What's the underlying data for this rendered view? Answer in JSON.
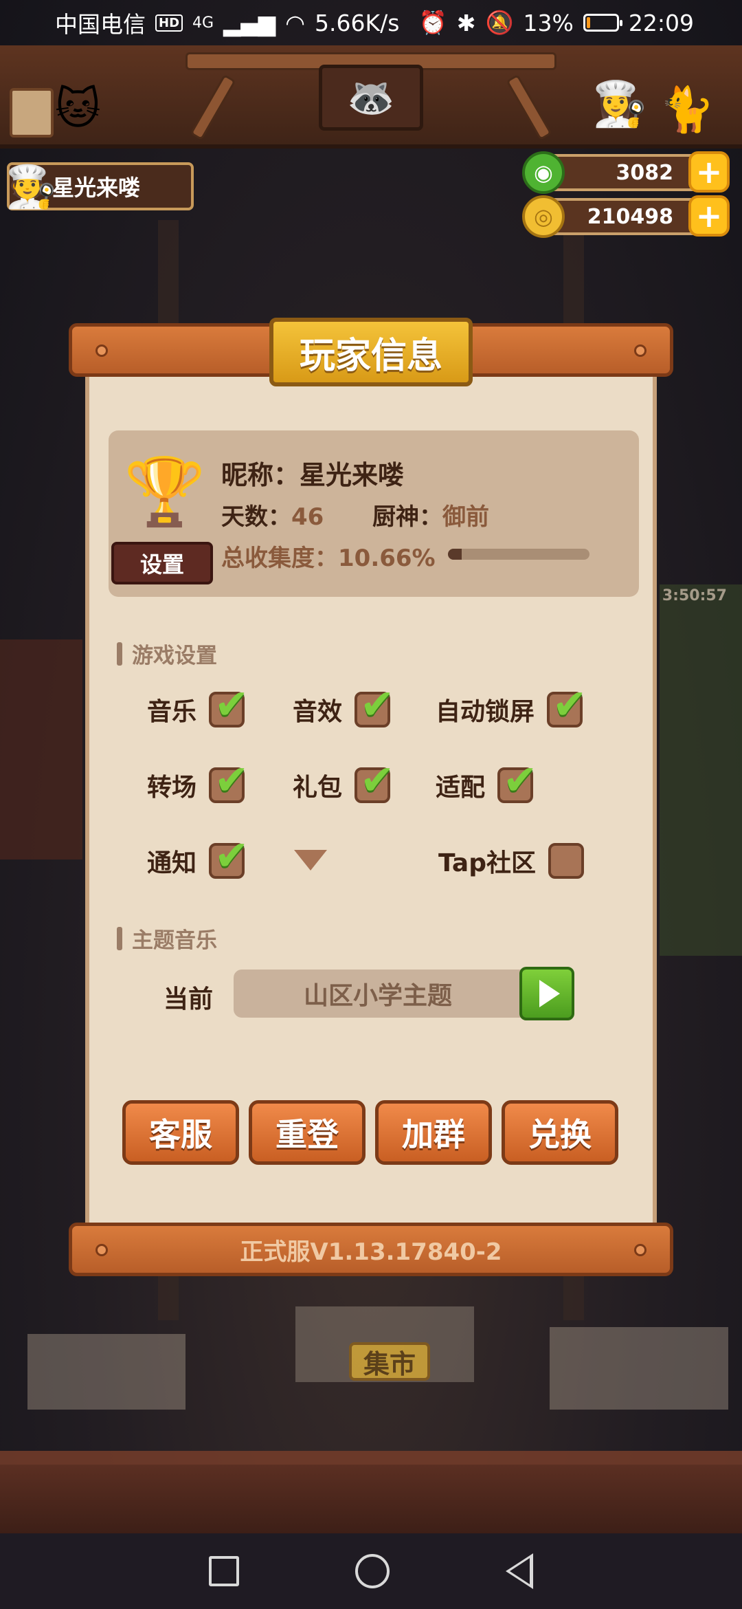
{
  "status_bar": {
    "carrier": "中国电信",
    "hd": "HD",
    "network": "4G",
    "speed": "5.66K/s",
    "battery": "13%",
    "battery_level": 0.13,
    "time": "22:09"
  },
  "player_tag": {
    "name": "星光来喽"
  },
  "currencies": {
    "gems": "3082",
    "coins": "210498"
  },
  "dialog": {
    "title": "玩家信息",
    "nickname_label": "昵称：",
    "nickname_value": "星光来喽",
    "days_label": "天数：",
    "days_value": "46",
    "chef_label": "厨神：",
    "chef_value": "御前",
    "collection_label": "总收集度：",
    "collection_value": "10.66%",
    "collection_progress": 0.0966,
    "settings_button": "设置",
    "game_settings_heading": "游戏设置",
    "options": [
      {
        "label": "音乐",
        "checked": true
      },
      {
        "label": "音效",
        "checked": true
      },
      {
        "label": "自动锁屏",
        "checked": true
      },
      {
        "label": "转场",
        "checked": true
      },
      {
        "label": "礼包",
        "checked": true
      },
      {
        "label": "适配",
        "checked": true
      },
      {
        "label": "通知",
        "checked": true
      },
      {
        "label": "Tap社区",
        "checked": false
      }
    ],
    "theme_music_heading": "主题音乐",
    "current_label": "当前",
    "current_theme": "山区小学主题",
    "buttons": {
      "support": "客服",
      "relogin": "重登",
      "join_group": "加群",
      "redeem": "兑换"
    },
    "version": "正式服V1.13.17840-2"
  },
  "background": {
    "market_sign": "集市",
    "side_countdown": "3:50:57"
  },
  "colors": {
    "dialog_bg": "#ebdcc6",
    "accent_orange": "#d97b3c",
    "title_gold": "#f4c33a",
    "check_green": "#7ccf3c"
  }
}
